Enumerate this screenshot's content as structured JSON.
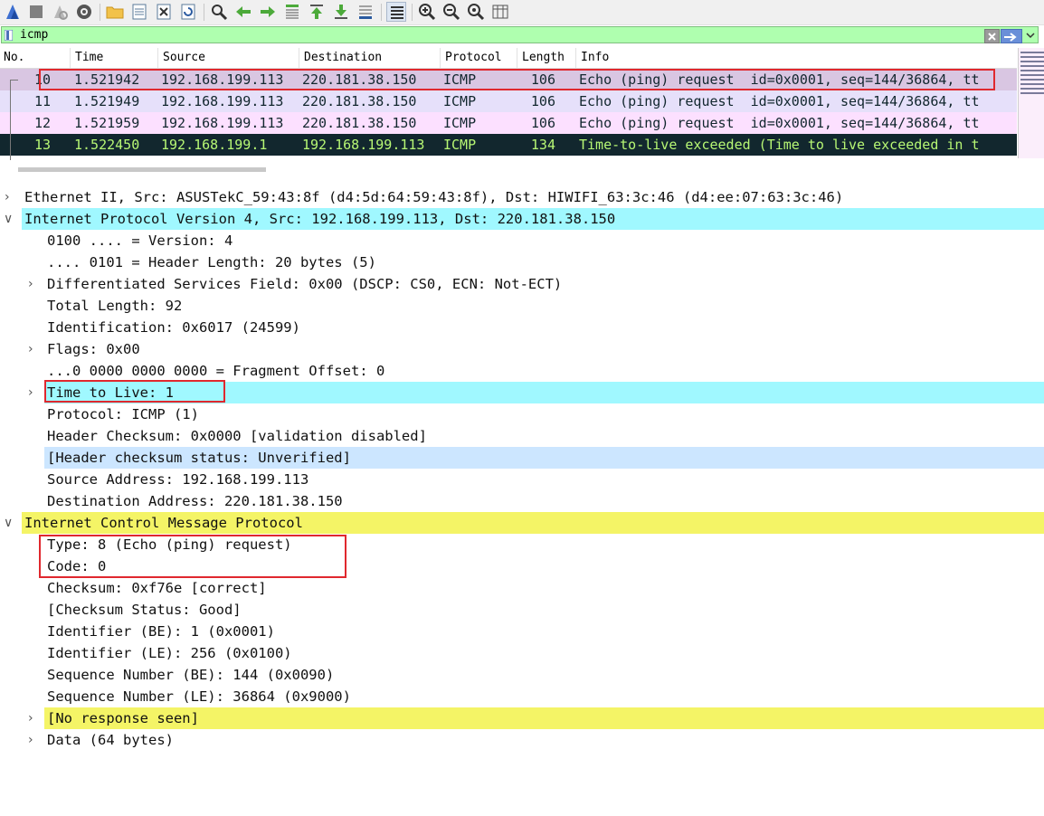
{
  "toolbar": {
    "icons": [
      "shark-fin-start-icon",
      "stop-capture-icon",
      "restart-capture-icon",
      "capture-options-icon",
      "open-file-icon",
      "save-file-icon",
      "close-file-icon",
      "reload-file-icon",
      "find-packet-icon",
      "go-back-icon",
      "go-forward-icon",
      "go-to-packet-icon",
      "go-first-icon",
      "go-last-icon",
      "autoscroll-icon",
      "colorize-icon",
      "zoom-in-icon",
      "zoom-out-icon",
      "zoom-normal-icon",
      "resize-columns-icon"
    ]
  },
  "filter": {
    "value": "icmp"
  },
  "packet_list": {
    "columns": [
      "No.",
      "Time",
      "Source",
      "Destination",
      "Protocol",
      "Length",
      "Info"
    ],
    "rows": [
      {
        "no": "10",
        "time": "1.521942",
        "source": "192.168.199.113",
        "destination": "220.181.38.150",
        "protocol": "ICMP",
        "length": "106",
        "info": "Echo (ping) request  id=0x0001, seq=144/36864, tt",
        "bg": "#d9c6e2",
        "fg": "#12272e"
      },
      {
        "no": "11",
        "time": "1.521949",
        "source": "192.168.199.113",
        "destination": "220.181.38.150",
        "protocol": "ICMP",
        "length": "106",
        "info": "Echo (ping) request  id=0x0001, seq=144/36864, tt",
        "bg": "#e6e0fa",
        "fg": "#12272e"
      },
      {
        "no": "12",
        "time": "1.521959",
        "source": "192.168.199.113",
        "destination": "220.181.38.150",
        "protocol": "ICMP",
        "length": "106",
        "info": "Echo (ping) request  id=0x0001, seq=144/36864, tt",
        "bg": "#fce0ff",
        "fg": "#12272e"
      },
      {
        "no": "13",
        "time": "1.522450",
        "source": "192.168.199.1",
        "destination": "192.168.199.113",
        "protocol": "ICMP",
        "length": "134",
        "info": "Time-to-live exceeded (Time to live exceeded in t",
        "bg": "#12272e",
        "fg": "#b7f774"
      }
    ]
  },
  "details": {
    "ethernet": "Ethernet II, Src: ASUSTekC_59:43:8f (d4:5d:64:59:43:8f), Dst: HIWIFI_63:3c:46 (d4:ee:07:63:3c:46)",
    "ip": "Internet Protocol Version 4, Src: 192.168.199.113, Dst: 220.181.38.150",
    "ip_fields": {
      "version": "0100 .... = Version: 4",
      "header_length": ".... 0101 = Header Length: 20 bytes (5)",
      "dsfield": "Differentiated Services Field: 0x00 (DSCP: CS0, ECN: Not-ECT)",
      "total_length": "Total Length: 92",
      "identification": "Identification: 0x6017 (24599)",
      "flags": "Flags: 0x00",
      "frag_offset": "...0 0000 0000 0000 = Fragment Offset: 0",
      "ttl": "Time to Live: 1",
      "protocol": "Protocol: ICMP (1)",
      "checksum": "Header Checksum: 0x0000 [validation disabled]",
      "checksum_status": "[Header checksum status: Unverified]",
      "src": "Source Address: 192.168.199.113",
      "dst": "Destination Address: 220.181.38.150"
    },
    "icmp": "Internet Control Message Protocol",
    "icmp_fields": {
      "type": "Type: 8 (Echo (ping) request)",
      "code": "Code: 0",
      "checksum": "Checksum: 0xf76e [correct]",
      "checksum_status": "[Checksum Status: Good]",
      "id_be": "Identifier (BE): 1 (0x0001)",
      "id_le": "Identifier (LE): 256 (0x0100)",
      "seq_be": "Sequence Number (BE): 144 (0x0090)",
      "seq_le": "Sequence Number (LE): 36864 (0x9000)",
      "no_response": "[No response seen]",
      "data": "Data (64 bytes)"
    }
  },
  "colors": {
    "ip_band": "#a0f8ff",
    "icmp_band": "#f4f466",
    "checksum_band": "#cce6ff",
    "highlight_box": "#e0282e",
    "filter_bg": "#afffaf"
  }
}
